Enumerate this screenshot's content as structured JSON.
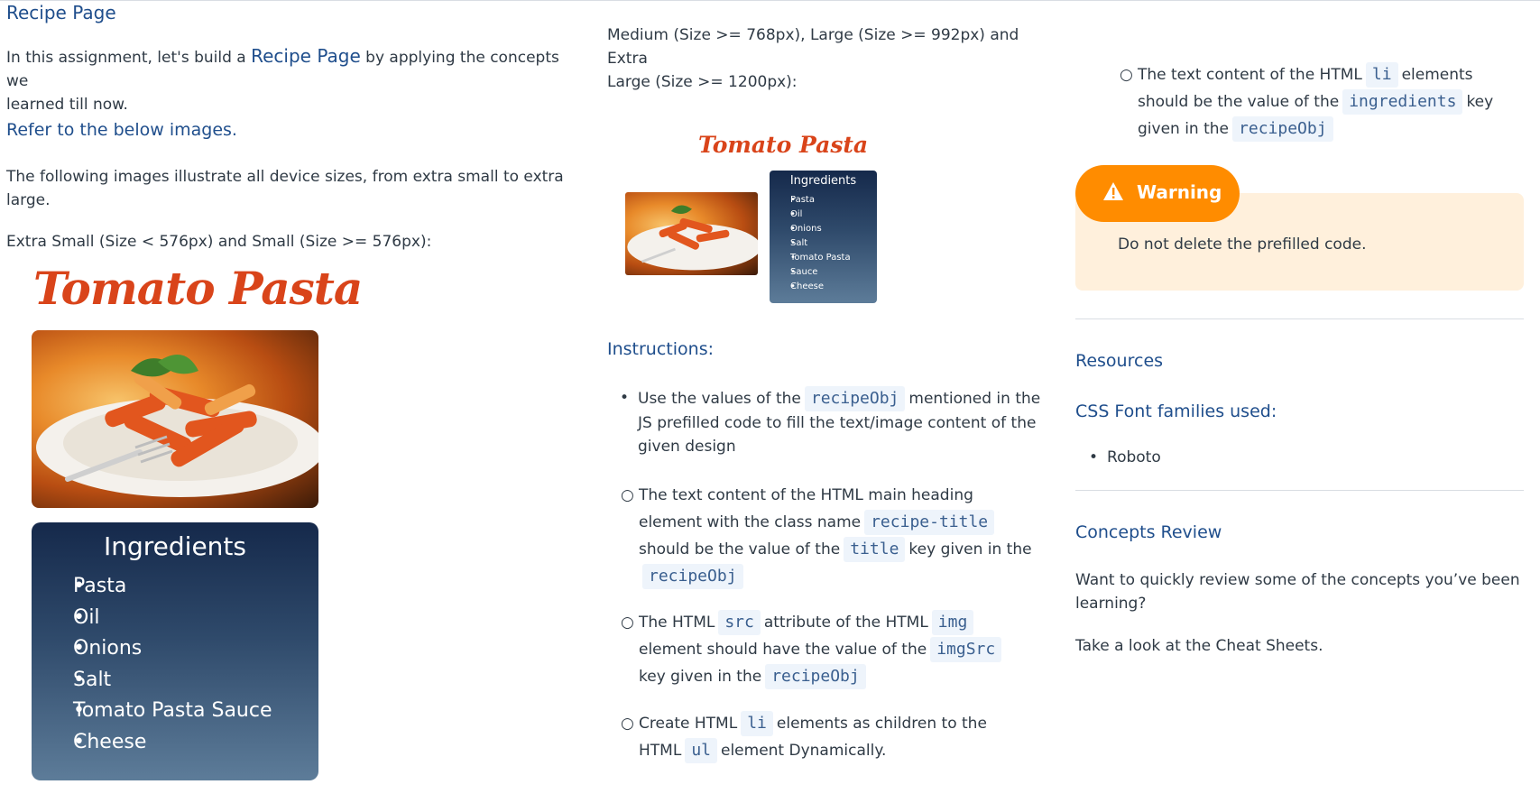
{
  "col1": {
    "heading": "Recipe Page",
    "intro_pre": "In this assignment, let's build a ",
    "intro_link": "Recipe Page",
    "intro_post": " by applying the concepts we",
    "intro_line2": "learned till now.",
    "refer": "Refer to the below images.",
    "following_l1": "The following images illustrate all device sizes, from extra small to extra",
    "following_l2": "large.",
    "xs_label": "Extra Small (Size < 576px) and Small (Size >= 576px):",
    "preview": {
      "title": "Tomato Pasta",
      "ingredients_heading": "Ingredients",
      "ingredients": [
        "Pasta",
        "Oil",
        "Onions",
        "Salt",
        "Tomato Pasta Sauce",
        "Cheese"
      ]
    }
  },
  "col2": {
    "md_l1": "Medium (Size >= 768px), Large (Size >= 992px) and Extra",
    "md_l2": "Large (Size >= 1200px):",
    "preview": {
      "title": "Tomato Pasta",
      "ingredients_heading": "Ingredients",
      "ingredients": [
        "Pasta",
        "Oil",
        "Onions",
        "Salt",
        "Tomato Pasta",
        "Sauce",
        "Cheese"
      ]
    },
    "instructions_heading": "Instructions:",
    "i1": {
      "a": "Use the values of the",
      "code": "recipeObj",
      "b": "mentioned in the",
      "l2": "JS prefilled code to fill the text/image content of the",
      "l3": "given design"
    },
    "i2": {
      "l1": "The text content of the HTML main heading",
      "l2a": "element with the class name",
      "code1": "recipe-title",
      "l3a": "should be the value of the",
      "code2": "title",
      "l3b": "key given in the",
      "code3": "recipeObj"
    },
    "i3": {
      "a": "The HTML",
      "code1": "src",
      "b": "attribute of the HTML",
      "code2": "img",
      "l2a": "element should have the value of the",
      "code3": "imgSrc",
      "l3a": "key given in the",
      "code4": "recipeObj"
    },
    "i4": {
      "a": "Create HTML",
      "code1": "li",
      "b": "elements as children to the",
      "l2a": "HTML",
      "code2": "ul",
      "l2b": "element Dynamically."
    }
  },
  "col3": {
    "li_note": {
      "a": "The text content of the HTML",
      "code1": "li",
      "b": "elements",
      "l2a": "should be the value of the",
      "code2": "ingredients",
      "l2b": "key",
      "l3a": "given in the",
      "code3": "recipeObj"
    },
    "warning_label": "Warning",
    "warning_text": "Do not delete the prefilled code.",
    "resources": "Resources",
    "fonts_heading": "CSS Font families used:",
    "fonts": [
      "Roboto"
    ],
    "concepts": "Concepts Review",
    "concepts_l1": "Want to quickly review some of the concepts you’ve been",
    "concepts_l2": "learning?",
    "cheat": "Take a look at the Cheat Sheets."
  },
  "colors": {
    "heading": "#1f4e8c",
    "warning": "#ff8c00",
    "warning_bg": "#fff0dc",
    "title_red": "#d9441a"
  }
}
